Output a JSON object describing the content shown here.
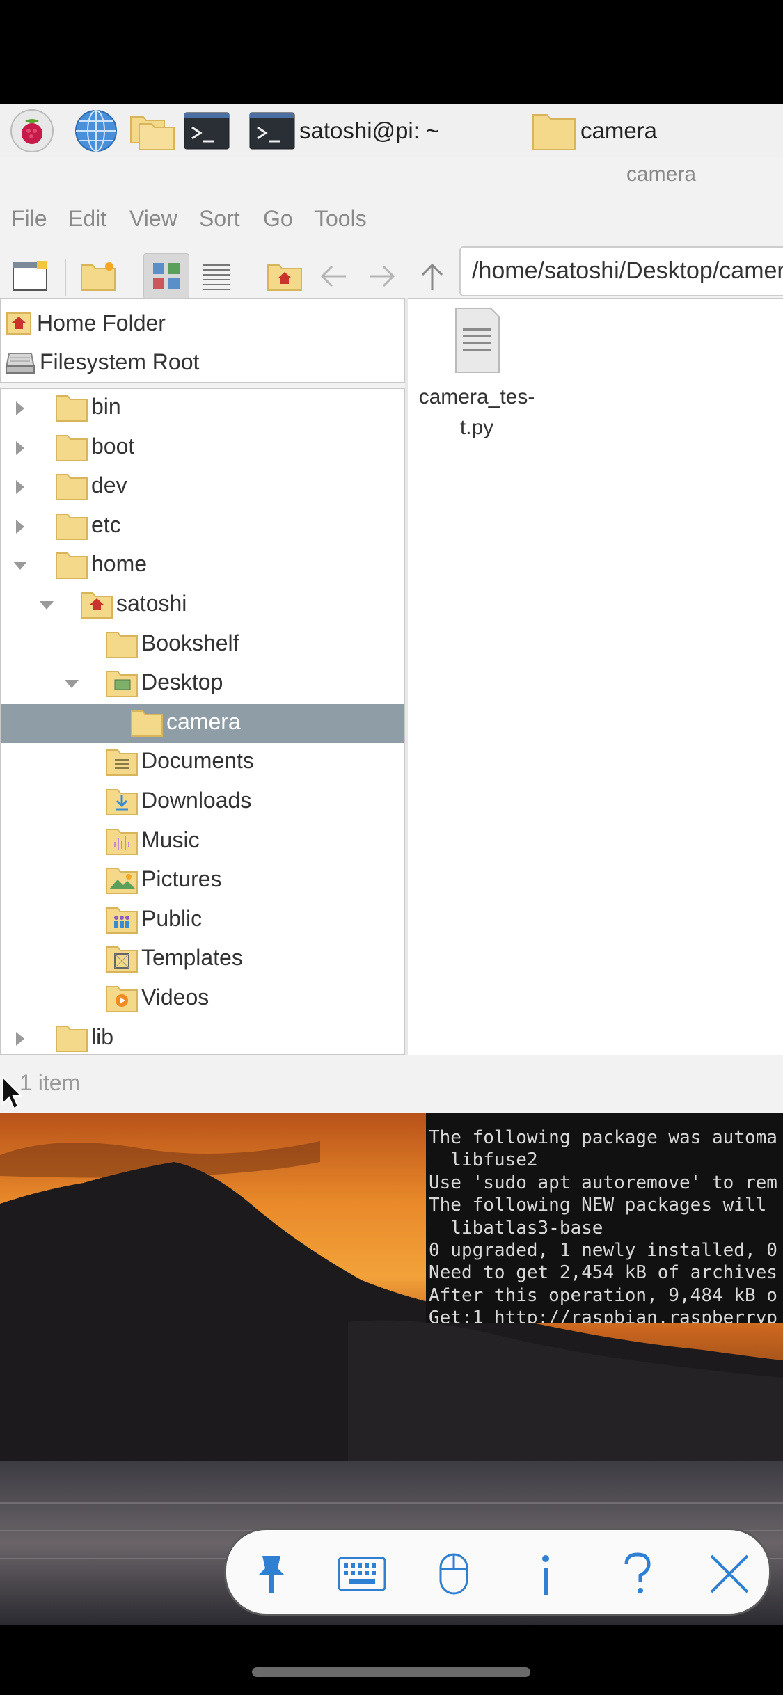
{
  "taskbar": {
    "terminal_title": "satoshi@pi: ~",
    "folder_title": "camera"
  },
  "window": {
    "title": "camera",
    "menu": [
      "File",
      "Edit",
      "View",
      "Sort",
      "Go",
      "Tools"
    ],
    "path": "/home/satoshi/Desktop/camera"
  },
  "places": [
    {
      "label": "Home Folder"
    },
    {
      "label": "Filesystem Root"
    }
  ],
  "tree": [
    {
      "label": "bin",
      "depth": 0,
      "expander": "collapsed",
      "icon": "folder"
    },
    {
      "label": "boot",
      "depth": 0,
      "expander": "collapsed",
      "icon": "folder"
    },
    {
      "label": "dev",
      "depth": 0,
      "expander": "collapsed",
      "icon": "folder"
    },
    {
      "label": "etc",
      "depth": 0,
      "expander": "collapsed",
      "icon": "folder"
    },
    {
      "label": "home",
      "depth": 0,
      "expander": "expanded",
      "icon": "folder"
    },
    {
      "label": "satoshi",
      "depth": 1,
      "expander": "expanded",
      "icon": "home-folder"
    },
    {
      "label": "Bookshelf",
      "depth": 2,
      "expander": "none",
      "icon": "folder"
    },
    {
      "label": "Desktop",
      "depth": 2,
      "expander": "expanded",
      "icon": "desktop-folder"
    },
    {
      "label": "camera",
      "depth": 3,
      "expander": "none",
      "icon": "folder",
      "selected": true
    },
    {
      "label": "Documents",
      "depth": 2,
      "expander": "none",
      "icon": "documents-folder"
    },
    {
      "label": "Downloads",
      "depth": 2,
      "expander": "none",
      "icon": "downloads-folder"
    },
    {
      "label": "Music",
      "depth": 2,
      "expander": "none",
      "icon": "music-folder"
    },
    {
      "label": "Pictures",
      "depth": 2,
      "expander": "none",
      "icon": "pictures-folder"
    },
    {
      "label": "Public",
      "depth": 2,
      "expander": "none",
      "icon": "public-folder"
    },
    {
      "label": "Templates",
      "depth": 2,
      "expander": "none",
      "icon": "templates-folder"
    },
    {
      "label": "Videos",
      "depth": 2,
      "expander": "none",
      "icon": "videos-folder"
    },
    {
      "label": "lib",
      "depth": 0,
      "expander": "collapsed",
      "icon": "folder"
    }
  ],
  "files": [
    {
      "name_line1": "camera_tes-",
      "name_line2": "t.py"
    }
  ],
  "status": "1 item",
  "terminal": [
    "The following package was automa",
    "  libfuse2",
    "Use 'sudo apt autoremove' to rem",
    "The following NEW packages will",
    "  libatlas3-base",
    "0 upgraded, 1 newly installed, 0",
    "Need to get 2,454 kB of archives",
    "After this operation, 9,484 kB o",
    "Get:1 http://raspbian.raspberryp"
  ],
  "colors": {
    "folder": "#f5d98a",
    "folder_edge": "#d8b55a",
    "selected_row": "#8e9da6",
    "home_red": "#c9332b"
  }
}
